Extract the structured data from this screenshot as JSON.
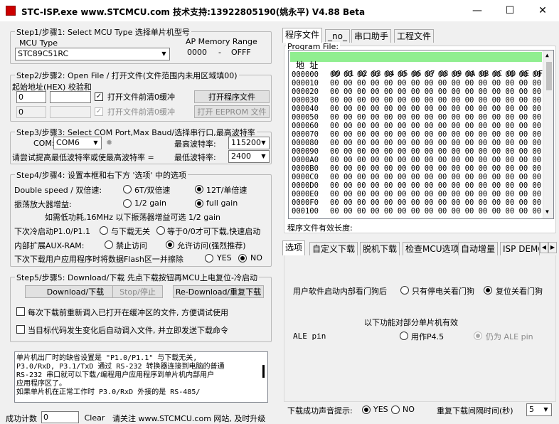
{
  "window": {
    "title": "STC-ISP.exe    www.STCMCU.com    技术支持:13922805190(姚永平)  V4.88 Beta",
    "minimize": "—",
    "maximize": "☐",
    "close": "✕"
  },
  "step1": {
    "legend": "Step1/步骤1: Select MCU Type  选择单片机型号",
    "mcu_type_label": "MCU Type",
    "mcu_value": "STC89C51RC",
    "ap_label": "AP Memory Range",
    "ap_start": "0000",
    "ap_dash": "-",
    "ap_end": "OFFF"
  },
  "step2": {
    "legend": "Step2/步骤2: Open File / 打开文件(文件范围内未用区域填00)",
    "start_addr_label": "起始地址(HEX) 校验和",
    "addr1": "0",
    "sum1": "",
    "addr2": "0",
    "sum2": "",
    "clear_buffer1": "打开文件前清0缓冲",
    "clear_buffer2": "打开文件前清0缓冲",
    "open_file_btn": "打开程序文件",
    "open_eeprom_btn": "打开 EEPROM 文件"
  },
  "step3": {
    "legend": "Step3/步骤3: Select COM Port,Max Baud/选择串行口,最高波特率",
    "com_label": "COM:",
    "com_value": "COM6",
    "max_baud_label": "最高波特率:",
    "max_baud_value": "115200",
    "hint": "请尝试提高最低波特率或使最高波特率 =",
    "min_baud_label": "最低波特率:",
    "min_baud_value": "2400"
  },
  "step4": {
    "legend": "Step4/步骤4: 设置本框和右下方 '选项' 中的选项",
    "double_speed_label": "Double speed / 双倍速:",
    "opt_6t": "6T/双倍速",
    "opt_12t": "12T/单倍速",
    "osc_gain_label": "振荡放大器增益:",
    "opt_half_gain": "1/2 gain",
    "opt_full_gain": "full gain",
    "gain_note": "如需低功耗,16MHz 以下振荡器增益可选 1/2 gain",
    "p1_label": "下次冷启动P1.0/P1.1",
    "opt_p1_unrelated": "与下载无关",
    "opt_p1_zero": "等于0/0才可下载,快速启动",
    "aux_ram_label": "内部扩展AUX-RAM:",
    "opt_aux_disable": "禁止访问",
    "opt_aux_allow": "允许访问(强烈推荐)",
    "erase_label": "下次下载用户应用程序时将数据Flash区一并擦除",
    "opt_yes": "YES",
    "opt_no": "NO"
  },
  "step5": {
    "legend": "Step5/步骤5: Download/下载   先点下载按钮再MCU上电复位-冷启动",
    "download_btn": "Download/下载",
    "stop_btn": "Stop/停止",
    "redownload_btn": "Re-Download/重复下载",
    "reload_check": "每次下载前重新调入已打开在缓冲区的文件, 方便调试使用",
    "auto_send_check": "当目标代码发生变化后自动调入文件, 并立即发送下载命令"
  },
  "message": {
    "lines": [
      "    单片机出厂时的缺省设置是 \"P1.0/P1.1\" 与下载无关,",
      "P3.0/RxD, P3.1/TxD 通过 RS-232 转换器连接到电脑的普通",
      "RS-232 串口就可以下载/编程用户应用程序到单片机内部用户",
      "应用程序区了。",
      "    如果单片机在正常工作时 P3.0/RxD 外接的是 RS-485/"
    ]
  },
  "statusbar": {
    "success_count_label": "成功计数",
    "success_count": "0",
    "clear_btn": "Clear",
    "notice": "请关注 www.STCMCU.com 网站, 及时升级"
  },
  "top_tabs": [
    "程序文件",
    "_no_",
    "串口助手",
    "工程文件"
  ],
  "program_file": {
    "legend": "Program File:",
    "addr_header": "地 址",
    "byte_headers": "00 01 02 03 04 05 06 07 08 09 0A 0B 0C 0D 0E 0F",
    "rows": [
      "000000",
      "000010",
      "000020",
      "000030",
      "000040",
      "000050",
      "000060",
      "000070",
      "000080",
      "000090",
      "0000A0",
      "0000B0",
      "0000C0",
      "0000D0",
      "0000E0",
      "0000F0",
      "000100"
    ],
    "row_bytes": "00 00 00 00 00 00 00 00 00 00 00 00 00 00 00 00",
    "valid_length_label": "程序文件有效长度:"
  },
  "bottom_tabs": [
    "选项",
    "自定义下载",
    "脱机下载",
    "检查MCU选项",
    "自动增量",
    "ISP DEMO"
  ],
  "options": {
    "watchdog_label": "用户软件启动内部看门狗后",
    "opt_wd_power": "只有停电关看门狗",
    "opt_wd_reset": "复位关看门狗",
    "partial_note": "以下功能对部分单片机有效",
    "ale_label": "ALE pin",
    "opt_ale_p45": "用作P4.5",
    "opt_ale_pin": "仍为 ALE pin",
    "sound_label": "下载成功声音提示:",
    "opt_sound_yes": "YES",
    "opt_sound_no": "NO",
    "interval_label": "重复下载间隔时间(秒)",
    "interval_value": "5"
  },
  "colors": {
    "hex_header_bg": "#90ee90",
    "accent": "#000000"
  }
}
